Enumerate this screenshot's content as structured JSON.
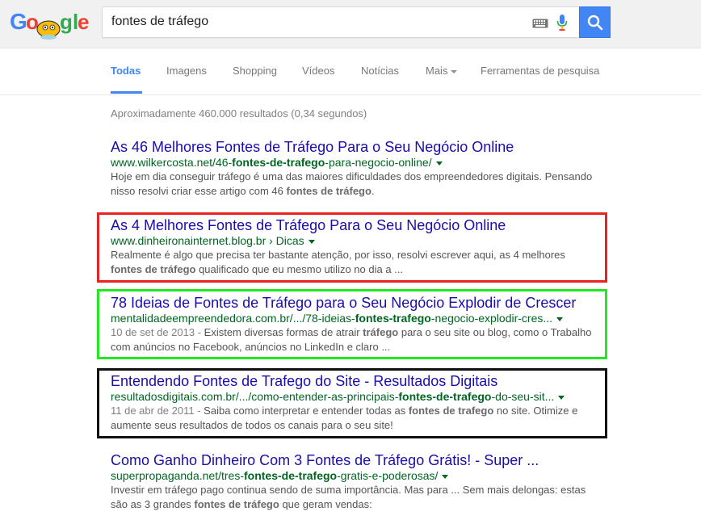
{
  "search": {
    "query": "fontes de tráfego"
  },
  "tabs": [
    {
      "label": "Todas"
    },
    {
      "label": "Imagens"
    },
    {
      "label": "Shopping"
    },
    {
      "label": "Vídeos"
    },
    {
      "label": "Notícias"
    },
    {
      "label": "Mais"
    },
    {
      "label": "Ferramentas de pesquisa"
    }
  ],
  "stats": "Aproximadamente 460.000 resultados (0,34 segundos)",
  "results": [
    {
      "title": "As 46 Melhores Fontes de Tráfego Para o Seu Negócio Online",
      "url_pre": "www.wilkercosta.net/46-",
      "url_bold": "fontes-de-trafego",
      "url_post": "-para-negocio-online/",
      "snippet_1": "Hoje em dia conseguir tráfego é uma das maiores dificuldades dos empreendedores digitais. Pensando nisso resolvi criar esse artigo com 46 ",
      "snippet_bold": "fontes de tráfego",
      "snippet_2": "."
    },
    {
      "title": "As 4 Melhores Fontes de Tráfego Para o Seu Negócio Online",
      "url_pre": "www.dinheironainternet.blog.br › Dicas",
      "snippet_1": "Realmente é algo que precisa ter bastante atenção, por isso, resolvi escrever aqui, as 4 melhores ",
      "snippet_bold": "fontes de tráfego",
      "snippet_2": " qualificado que eu mesmo utilizo no dia a ..."
    },
    {
      "title": "78 Ideias de Fontes de Tráfego para o Seu Negócio Explodir de Crescer",
      "url_pre": "mentalidadeempreendedora.com.br/.../78-ideias-",
      "url_bold": "fontes-trafego",
      "url_post": "-negocio-explodir-cres...",
      "date": "10 de set de 2013 - ",
      "snippet_1": "Existem diversas formas de atrair ",
      "snippet_bold": "tráfego",
      "snippet_2": " para o seu site ou blog, como o Trabalho com anúncios no Facebook, anúncios no LinkedIn e claro ..."
    },
    {
      "title": "Entendendo Fontes de Trafego do Site - Resultados Digitais",
      "url_pre": "resultadosdigitais.com.br/.../como-entender-as-principais-",
      "url_bold": "fontes-de-trafego",
      "url_post": "-do-seu-sit...",
      "date": "11 de abr de 2011 - ",
      "snippet_1": "Saiba como interpretar e entender todas as ",
      "snippet_bold": "fontes de trafego",
      "snippet_2": " no site. Otimize e aumente seus resultados de todos os canais para o seu site!"
    },
    {
      "title": "Como Ganho Dinheiro Com 3 Fontes de Tráfego Grátis! - Super ...",
      "url_pre": "superpropaganda.net/tres-",
      "url_bold": "fontes-de-trafego",
      "url_post": "-gratis-e-poderosas/",
      "snippet_1": "Investir em tráfego pago continua sendo de suma importância. Mas para ... Sem mais delongas: estas são as 3 grandes ",
      "snippet_bold": "fontes de tráfego",
      "snippet_2": " que geram vendas:"
    }
  ],
  "colors": {
    "accent": "#4285f4",
    "link": "#1a0dab",
    "url": "#006621",
    "highlight_red": "#e8231f",
    "highlight_green": "#22e822",
    "highlight_black": "#111111"
  }
}
